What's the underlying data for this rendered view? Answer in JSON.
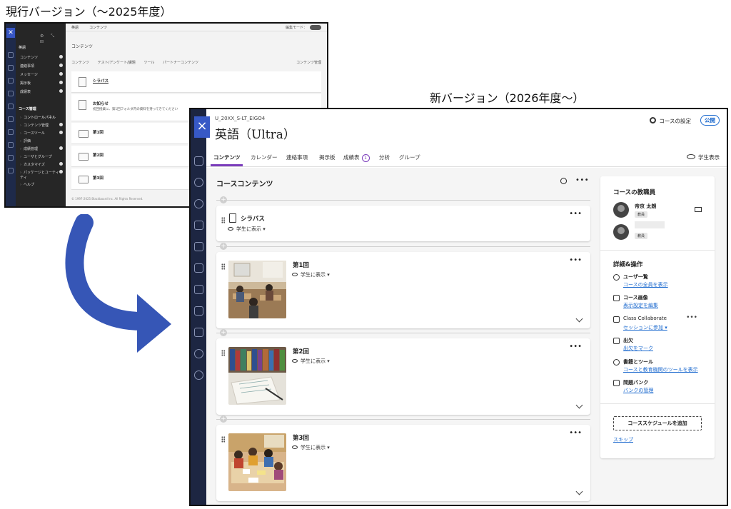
{
  "captions": {
    "old": "現行バージョン（〜2025年度）",
    "new": "新バージョン（2026年度〜）"
  },
  "old_ui": {
    "course": "英語",
    "top_tabs": [
      "英語",
      "コンテンツ"
    ],
    "edit_mode": "編集モード：",
    "menu_section": "英語",
    "menu_items": [
      "コンテンツ",
      "連絡事項",
      "メッセージ",
      "掲示板",
      "成績表"
    ],
    "admin_section": "コース管理",
    "admin_items": [
      "コントロールパネル",
      "コンテンツ管理",
      "コースツール",
      "評価",
      "成績管理",
      "ユーザとグループ",
      "カスタマイズ",
      "パッケージとユーティリティ",
      "ヘルプ"
    ],
    "page_title": "コンテンツ",
    "action_bar": [
      "コンテンツ",
      "テスト/アンケート/課題",
      "ツール",
      "パートナーコンテンツ"
    ],
    "action_right": "コンテンツ管理",
    "rows": [
      {
        "label": "シラバス",
        "sub": ""
      },
      {
        "label": "お知らせ",
        "sub": "初回授業に、第1回フォルダ内の資料を持ってきてください"
      },
      {
        "label": "第1回",
        "sub": ""
      },
      {
        "label": "第2回",
        "sub": ""
      },
      {
        "label": "第3回",
        "sub": ""
      }
    ],
    "footer": "© 1997-2025 Blackboard Inc. All Rights Reserved."
  },
  "new_ui": {
    "course_code": "U_20XX_S-LT_EIGO4",
    "course_title": "英語（Ultra）",
    "settings_label": "コースの設定",
    "status_badge": "公開",
    "tabs": [
      "コンテンツ",
      "カレンダー",
      "連絡事項",
      "掲示板",
      "成績表",
      "分析",
      "グループ"
    ],
    "grades_badge": "1",
    "student_view": "学生表示",
    "content_title": "コースコンテンツ",
    "visibility": "学生に表示",
    "items": [
      {
        "title": "シラバス"
      },
      {
        "title": "第1回"
      },
      {
        "title": "第2回"
      },
      {
        "title": "第3回"
      }
    ],
    "panel": {
      "faculty_heading": "コースの教職員",
      "faculty_name": "帝京 太朗",
      "faculty_role": "教員",
      "faculty2_role": "教員",
      "details_heading": "詳細&操作",
      "actions": [
        {
          "title": "ユーザ一覧",
          "link": "コースの全員を表示"
        },
        {
          "title": "コース画像",
          "link": "表示設定を編集"
        },
        {
          "title": "Class Collaborate",
          "link": "セッションに参加"
        },
        {
          "title": "出欠",
          "link": "出欠をマーク"
        },
        {
          "title": "書籍とツール",
          "link": "コースと教育機関のツールを表示"
        },
        {
          "title": "問題バンク",
          "link": "バンクの管理"
        }
      ],
      "schedule_button": "コーススケジュールを追加",
      "skip": "スキップ"
    }
  },
  "colors": {
    "accent_purple": "#7b3dbb",
    "link_blue": "#1e6bcf",
    "nav_dark": "#1d2642",
    "arrow_blue": "#3656b6"
  }
}
